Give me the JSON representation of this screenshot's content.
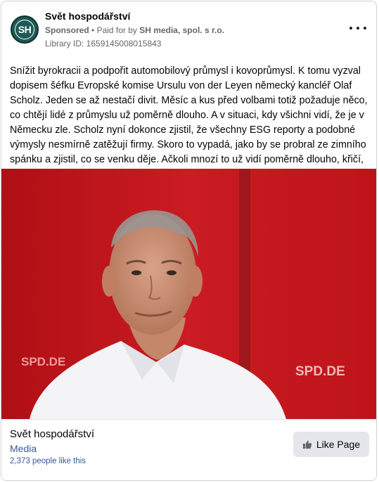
{
  "ad": {
    "page_name": "Svět hospodářství",
    "avatar_initials": "SH",
    "sponsored_label": "Sponsored",
    "separator": "•",
    "paid_for_prefix": "Paid for by",
    "advertiser": "SH media, spol. s r.o.",
    "library_id": "Library ID: 1659145008015843",
    "more_icon": "more-horizontal-icon",
    "body_text": "Snížit byrokracii a podpořit automobilový průmysl i kovoprůmysl. K tomu vyzval dopisem šéfku Evropské komise Ursulu von der Leyen německý kancléř Olaf Scholz. Jeden se až nestačí divit. Měsíc a kus před volbami totiž požaduje něco, co chtějí lidé z průmyslu už poměrně dlouho. A v situaci, kdy všichni vidí, že je v Německu zle. Scholz nyní dokonce zjistil, že všechny ESG reporty a podobné výmysly nesmírně zatěžují firmy. Skoro to vypadá, jako by se probral ze zimního spánku a zjistil, co se venku děje. Ačkoli mnozí to už vidí poměrně dlouho, křičí, al…",
    "image": {
      "banner_text_left": "SPD.DE",
      "banner_text_right": "SPD.DE"
    },
    "footer": {
      "page_name": "Svět hospodářství",
      "category": "Media",
      "likes": "2,373 people like this",
      "like_button_label": "Like Page",
      "like_icon": "thumbs-up-icon"
    }
  },
  "colors": {
    "avatar_bg": "#1d5a55",
    "backdrop_red": "#c4161c",
    "link_blue": "#385898",
    "muted_gray": "#65676b"
  }
}
